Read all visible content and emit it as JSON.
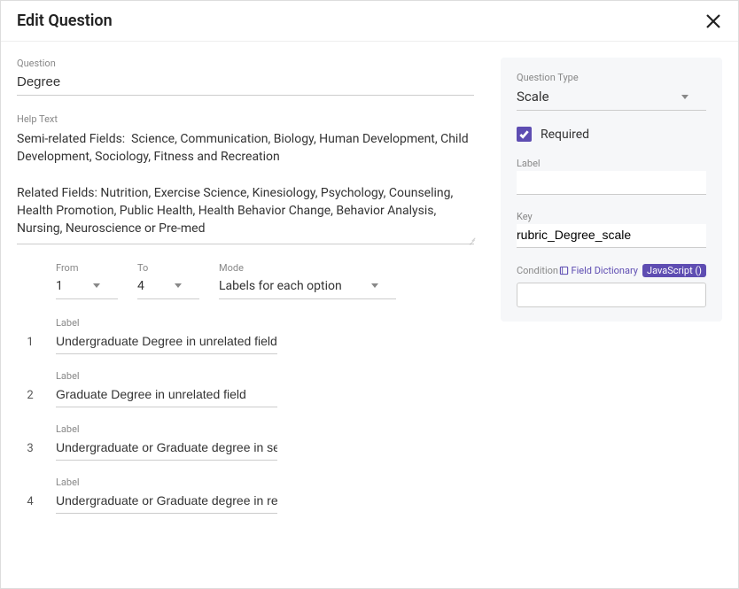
{
  "header": {
    "title": "Edit Question"
  },
  "left": {
    "question_label": "Question",
    "question_value": "Degree",
    "helptext_label": "Help Text",
    "helptext_value": "Semi-related Fields:  Science, Communication, Biology, Human Development, Child Development, Sociology, Fitness and Recreation\n\nRelated Fields: Nutrition, Exercise Science, Kinesiology, Psychology, Counseling, Health Promotion, Public Health, Health Behavior Change, Behavior Analysis, Nursing, Neuroscience or Pre-med",
    "scale": {
      "from_label": "From",
      "from_value": "1",
      "to_label": "To",
      "to_value": "4",
      "mode_label": "Mode",
      "mode_value": "Labels for each option",
      "options": [
        {
          "num": "1",
          "label_heading": "Label",
          "value": "Undergraduate Degree in unrelated field (i"
        },
        {
          "num": "2",
          "label_heading": "Label",
          "value": "Graduate Degree in unrelated field"
        },
        {
          "num": "3",
          "label_heading": "Label",
          "value": "Undergraduate or Graduate degree in sem"
        },
        {
          "num": "4",
          "label_heading": "Label",
          "value": "Undergraduate or Graduate degree in rela"
        }
      ]
    }
  },
  "right": {
    "type_label": "Question Type",
    "type_value": "Scale",
    "required_label": "Required",
    "required_checked": true,
    "label_heading": "Label",
    "label_value": "",
    "key_label": "Key",
    "key_value": "rubric_Degree_scale",
    "condition_label": "Condition",
    "field_dictionary_label": "Field Dictionary",
    "js_badge": "JavaScript ()",
    "condition_value": ""
  }
}
